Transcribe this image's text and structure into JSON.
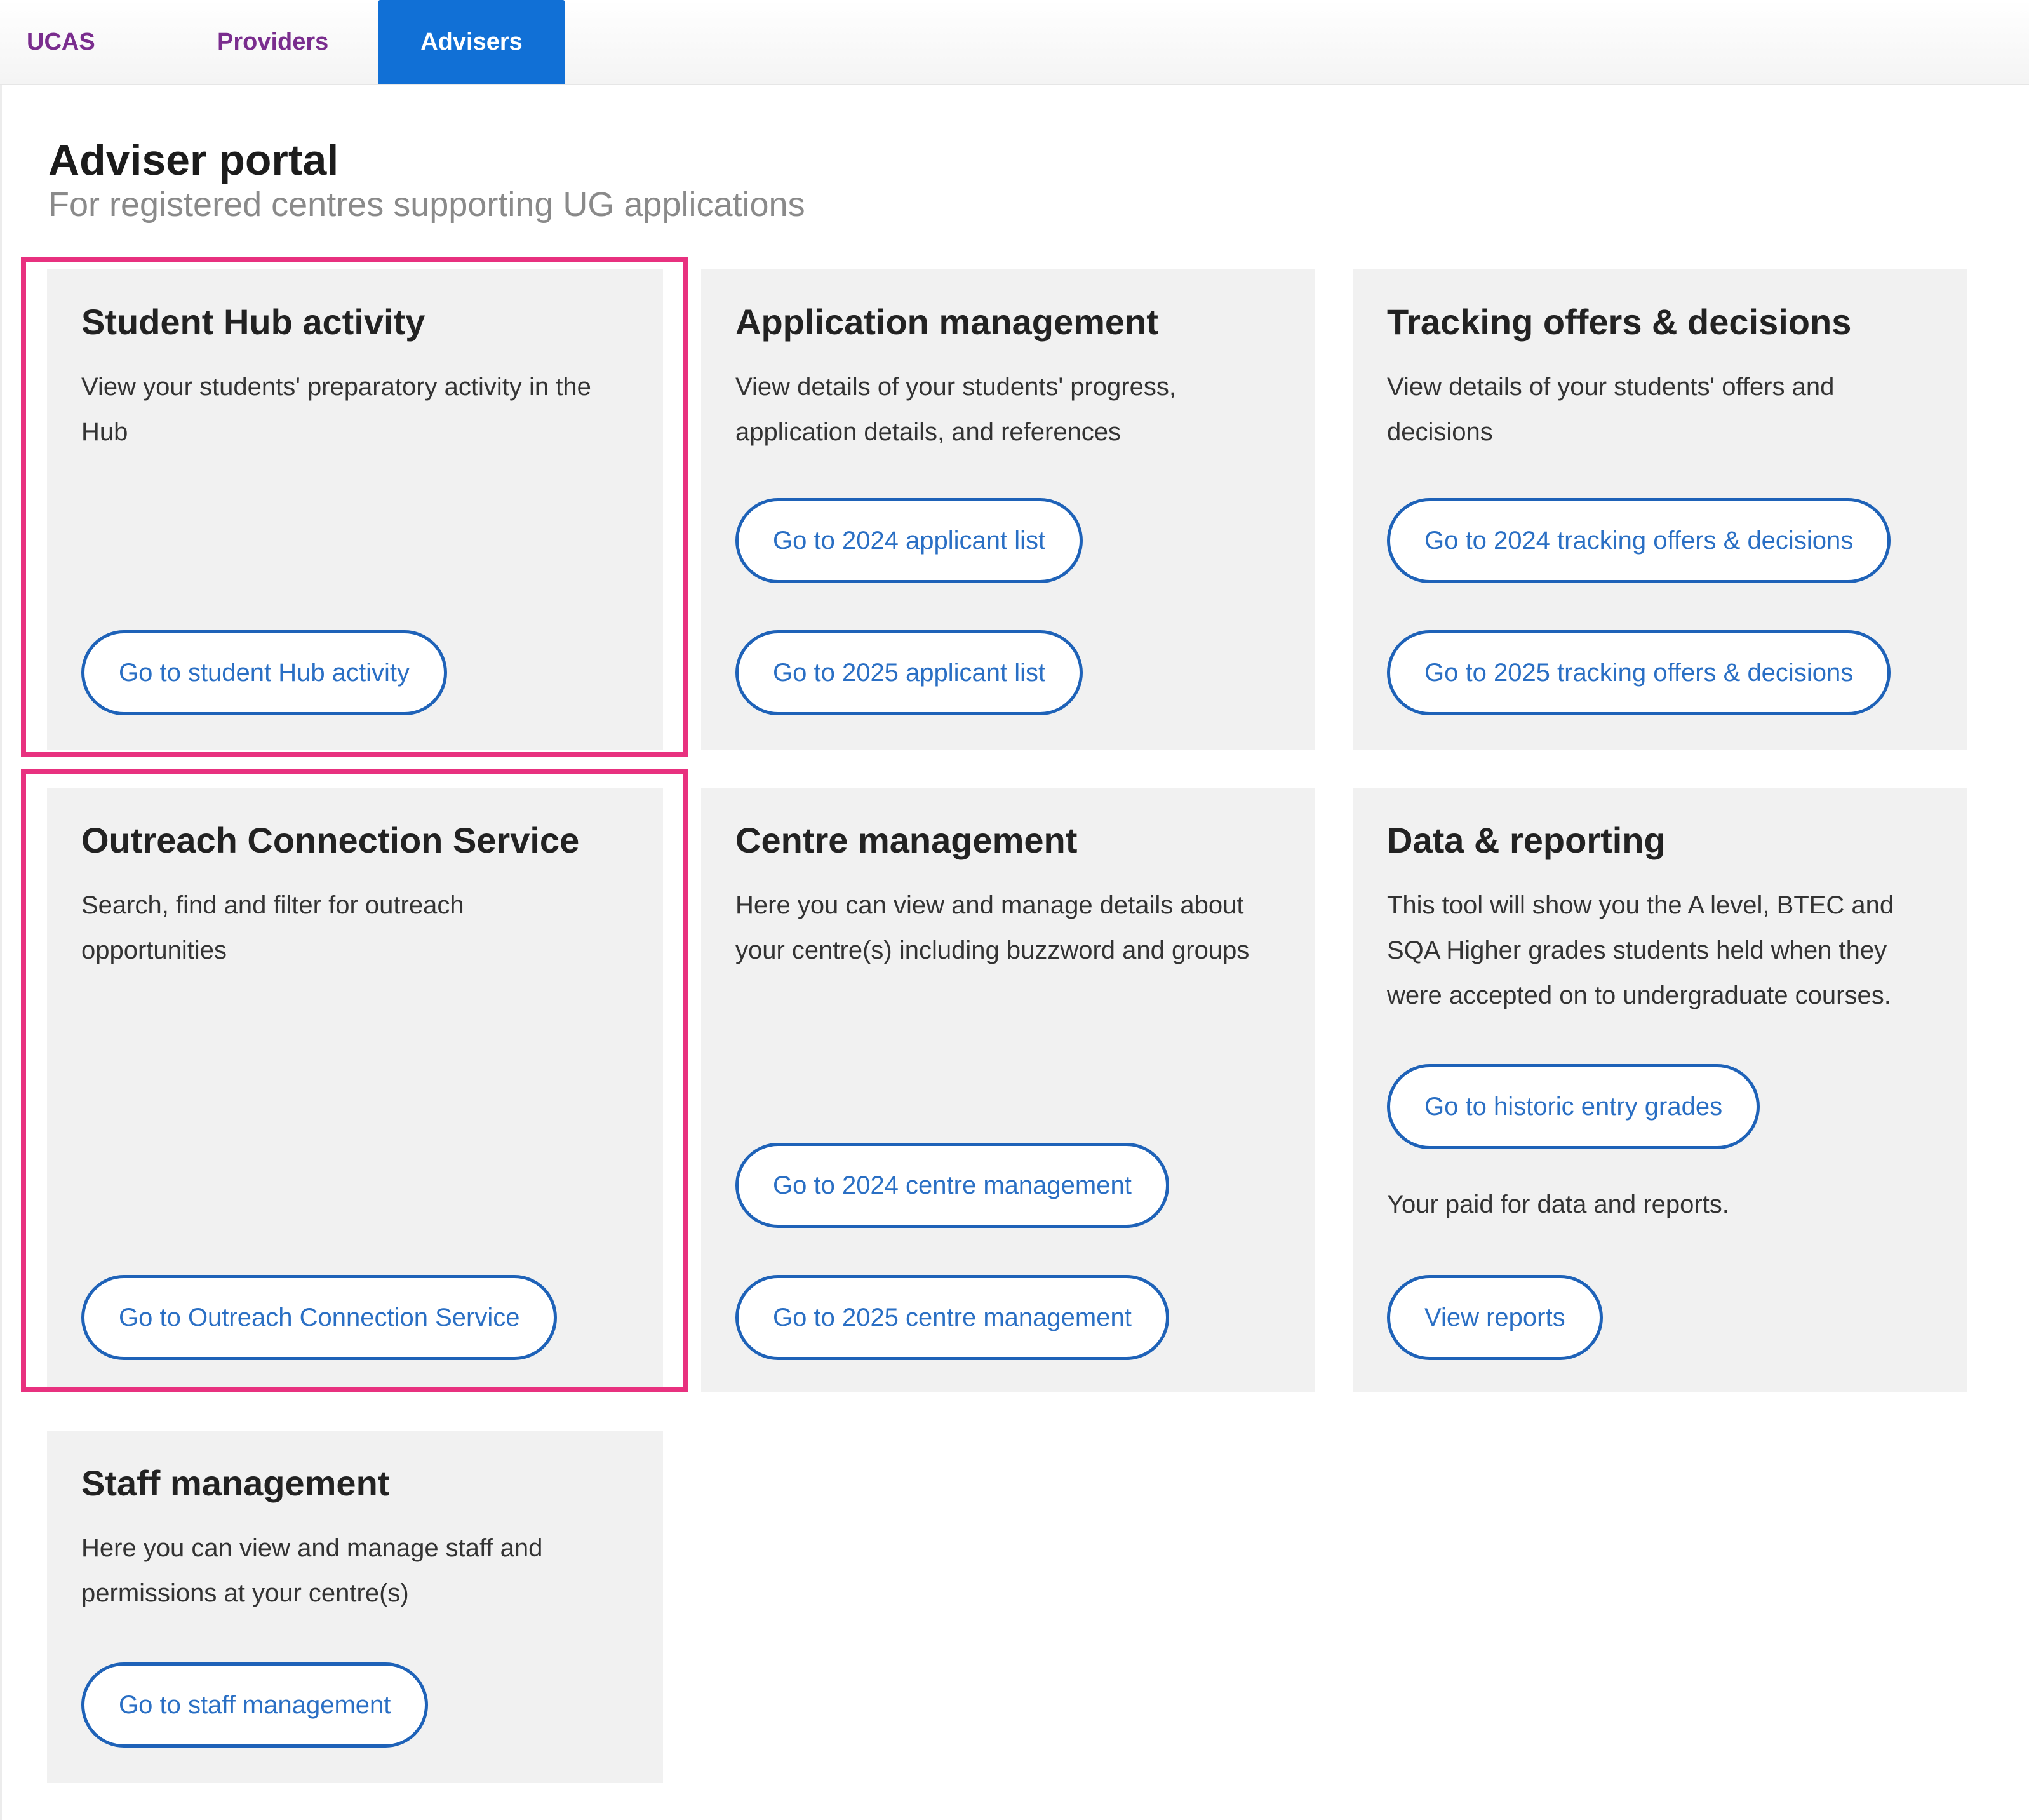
{
  "nav": {
    "tabs": [
      {
        "label": "UCAS"
      },
      {
        "label": "Providers"
      },
      {
        "label": "Advisers"
      }
    ],
    "active_tab": "Advisers"
  },
  "header": {
    "title": "Adviser portal",
    "subtitle": "For registered centres supporting UG applications"
  },
  "cards": {
    "student_hub": {
      "title": "Student Hub activity",
      "description": "View your students' preparatory activity in the\nHub",
      "buttons": [
        "Go to student Hub activity"
      ]
    },
    "application_management": {
      "title": "Application management",
      "description": "View details of your students' progress,\napplication details, and references",
      "buttons": [
        "Go to 2024 applicant list",
        "Go to 2025 applicant list"
      ]
    },
    "tracking": {
      "title": "Tracking offers & decisions",
      "description": "View details of your students' offers and\ndecisions",
      "buttons": [
        "Go to 2024 tracking offers & decisions",
        "Go to 2025 tracking offers & decisions"
      ]
    },
    "outreach": {
      "title": "Outreach Connection Service",
      "description": "Search, find and filter for outreach\nopportunities",
      "buttons": [
        "Go to Outreach Connection Service"
      ]
    },
    "centre_management": {
      "title": "Centre management",
      "description": "Here you can view and manage details about\nyour centre(s) including buzzword and groups",
      "buttons": [
        "Go to 2024 centre management",
        "Go to 2025 centre management"
      ]
    },
    "data_reporting": {
      "title": "Data & reporting",
      "description": "This tool will show you the A level, BTEC and\nSQA Higher grades students held when they\nwere accepted on to undergraduate courses.",
      "buttons": [
        "Go to historic entry grades",
        "View reports"
      ],
      "note": "Your paid for data and reports."
    },
    "staff_management": {
      "title": "Staff management",
      "description": "Here you can view and manage staff and\npermissions at your centre(s)",
      "buttons": [
        "Go to staff management"
      ]
    }
  },
  "colors": {
    "accent": "#1170d6",
    "tab_text": "#7a2d8e",
    "highlight": "#e8317f",
    "button_border": "#1e62b8",
    "card_bg": "#f1f1f1"
  }
}
